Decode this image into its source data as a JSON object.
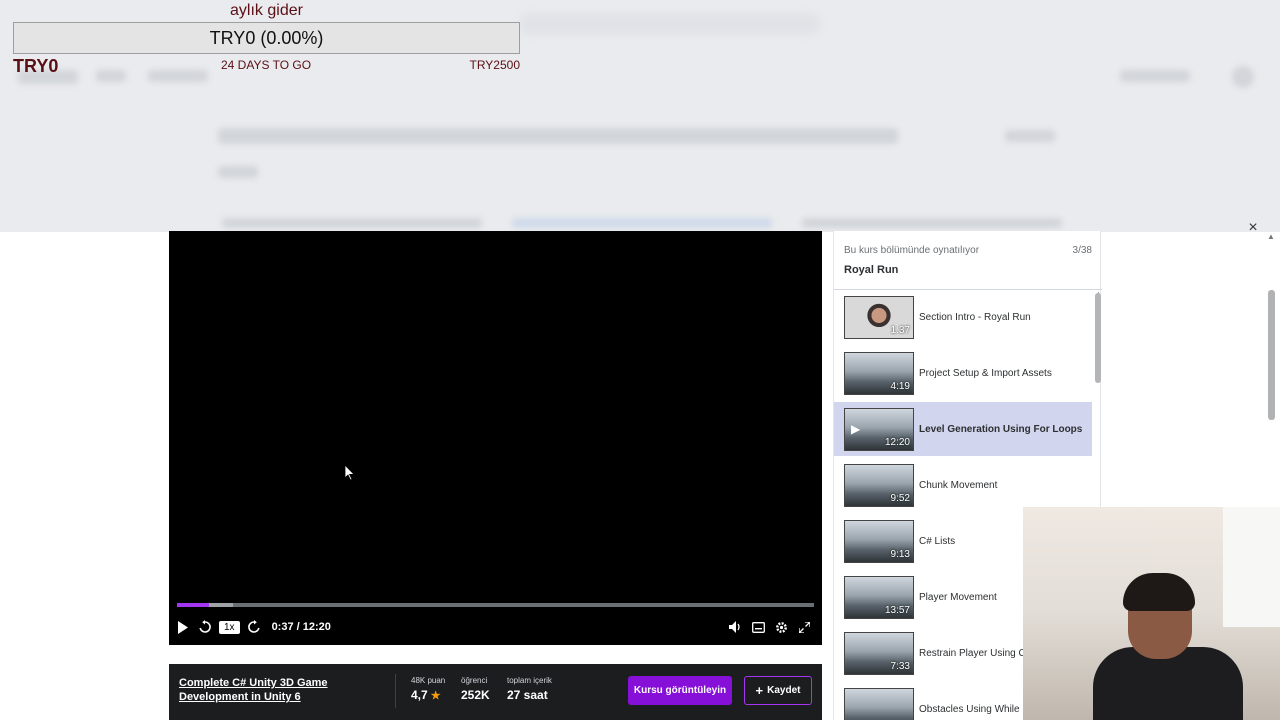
{
  "donation_goal": {
    "title": "aylık gider",
    "progress_text": "TRY0 (0.00%)",
    "progress": 0.0,
    "current": "TRY0",
    "days_left": "24 DAYS TO GO",
    "target": "TRY2500"
  },
  "player": {
    "close_icon": "×",
    "speed": "1x",
    "time": "0:37 / 12:20",
    "played_fraction": 0.05,
    "icons": [
      "play-icon",
      "rewind-icon",
      "forward-icon",
      "volume-icon",
      "captions-icon",
      "settings-icon",
      "fullscreen-icon"
    ]
  },
  "course": {
    "title": "Complete C# Unity 3D Game Development in Unity 6",
    "rating_label": "48K puan",
    "rating": "4,7",
    "students_label": "öğrenci",
    "students": "252K",
    "content_label": "toplam içerik",
    "content": "27 saat",
    "view_button": "Kursu görüntüleyin",
    "save_button": "Kaydet"
  },
  "sidebar": {
    "section_label": "Bu kurs bölümünde oynatılıyor",
    "position": "3/38",
    "section_name": "Royal Run",
    "lessons": [
      {
        "title": "Section Intro - Royal Run",
        "duration": "1:37"
      },
      {
        "title": "Project Setup & Import Assets",
        "duration": "4:19"
      },
      {
        "title": "Level Generation Using For Loops",
        "duration": "12:20"
      },
      {
        "title": "Chunk Movement",
        "duration": "9:52"
      },
      {
        "title": "C# Lists",
        "duration": "9:13"
      },
      {
        "title": "Player Movement",
        "duration": "13:57"
      },
      {
        "title": "Restrain Player Using Clam",
        "duration": "7:33"
      },
      {
        "title": "Obstacles Using While Lo",
        "duration": ""
      }
    ]
  }
}
